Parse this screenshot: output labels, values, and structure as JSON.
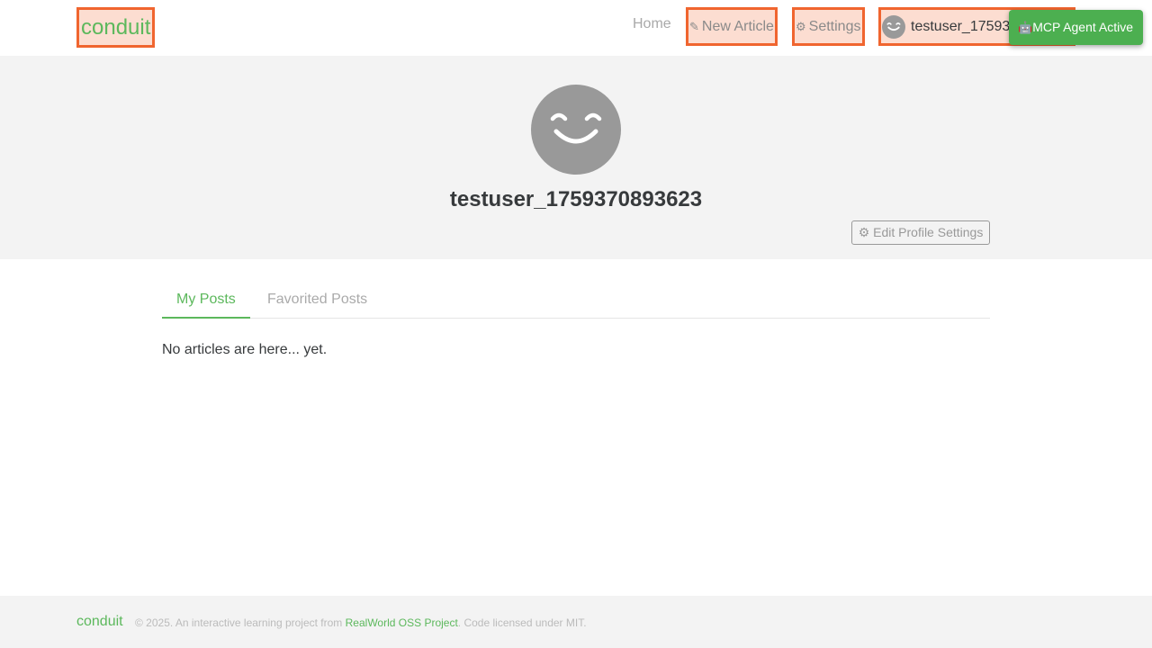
{
  "navbar": {
    "brand": "conduit",
    "home": "Home",
    "new_article": "New Article",
    "settings": "Settings",
    "user": "testuser_17593",
    "new_article_icon": "edit-icon",
    "settings_icon": "gear-icon"
  },
  "mcp_badge": {
    "icon": "robot-icon",
    "label": "MCP Agent Active"
  },
  "profile": {
    "username": "testuser_1759370893623",
    "edit_button": "Edit Profile Settings"
  },
  "tabs": [
    {
      "label": "My Posts",
      "active": true
    },
    {
      "label": "Favorited Posts",
      "active": false
    }
  ],
  "empty_message": "No articles are here... yet.",
  "footer": {
    "brand": "conduit",
    "text_prefix": "© 2025. An interactive learning project from ",
    "link": "RealWorld OSS Project",
    "text_suffix": ". Code licensed under MIT."
  },
  "colors": {
    "brand": "#5cb85c",
    "highlight": "#f0652f",
    "badge": "#4caf50"
  }
}
